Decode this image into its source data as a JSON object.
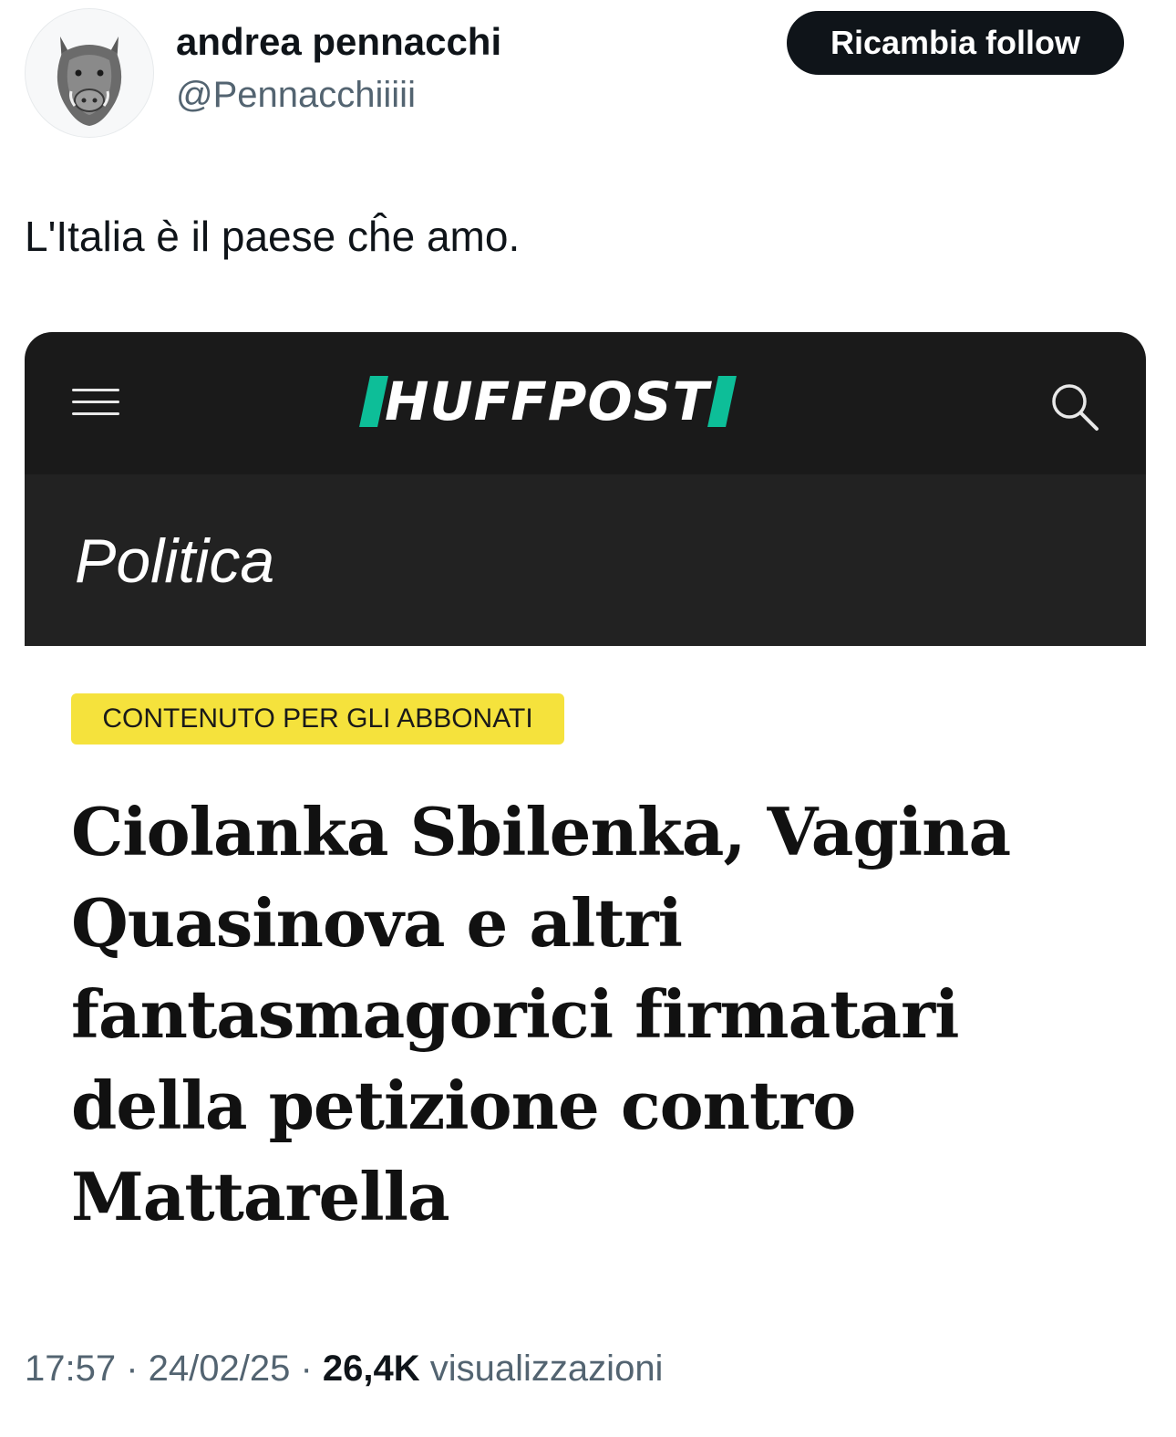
{
  "author": {
    "display_name": "andrea pennacchi",
    "handle": "@Pennacchiiiii",
    "avatar_icon": "boar-avatar"
  },
  "follow_button": {
    "label": "Ricambia follow"
  },
  "tweet": {
    "text": "L'Italia è il paese cĥe amo."
  },
  "embedded_image": {
    "site": {
      "logo_text": "HUFFPOST",
      "logo_accent_color": "#0dbe98",
      "menu_icon": "hamburger-menu-icon",
      "search_icon": "magnifier-icon"
    },
    "section": "Politica",
    "badge": {
      "label": "CONTENUTO PER GLI ABBONATI",
      "color": "#f5e23c"
    },
    "headline_lines": [
      "Ciolanka Sbilenka, Vagina",
      "Quasinova e altri",
      "fantasmagorici firmatari",
      "della petizione contro",
      "Mattarella"
    ]
  },
  "meta": {
    "time": "17:57",
    "separator": " · ",
    "date": "24/02/25",
    "views_count": "26,4K",
    "views_label": "visualizzazioni"
  }
}
